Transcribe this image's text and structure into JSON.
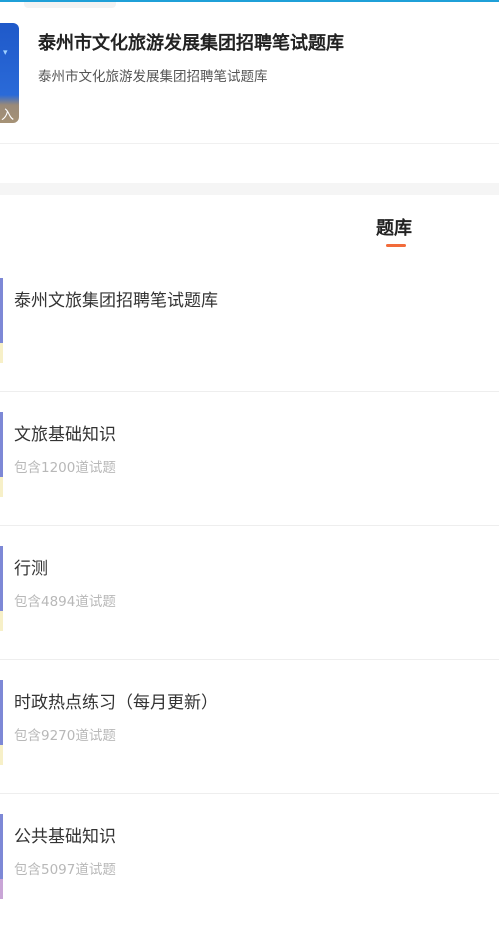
{
  "header": {
    "cover_label": "入",
    "cover_mark": "▾",
    "title": "泰州市文化旅游发展集团招聘笔试题库",
    "subtitle": "泰州市文化旅游发展集团招聘笔试题库"
  },
  "tabs": [
    {
      "label": "题库",
      "active": true
    }
  ],
  "colors": {
    "accent_underline": "#f26b3a",
    "top_line": "#1fa0d8",
    "item_bar": "#7d88d6"
  },
  "items": [
    {
      "name": "泰州文旅集团招聘笔试题库",
      "count": ""
    },
    {
      "name": "文旅基础知识",
      "count": "包含1200道试题"
    },
    {
      "name": "行测",
      "count": "包含4894道试题"
    },
    {
      "name": "时政热点练习（每月更新）",
      "count": "包含9270道试题"
    },
    {
      "name": "公共基础知识",
      "count": "包含5097道试题"
    }
  ]
}
